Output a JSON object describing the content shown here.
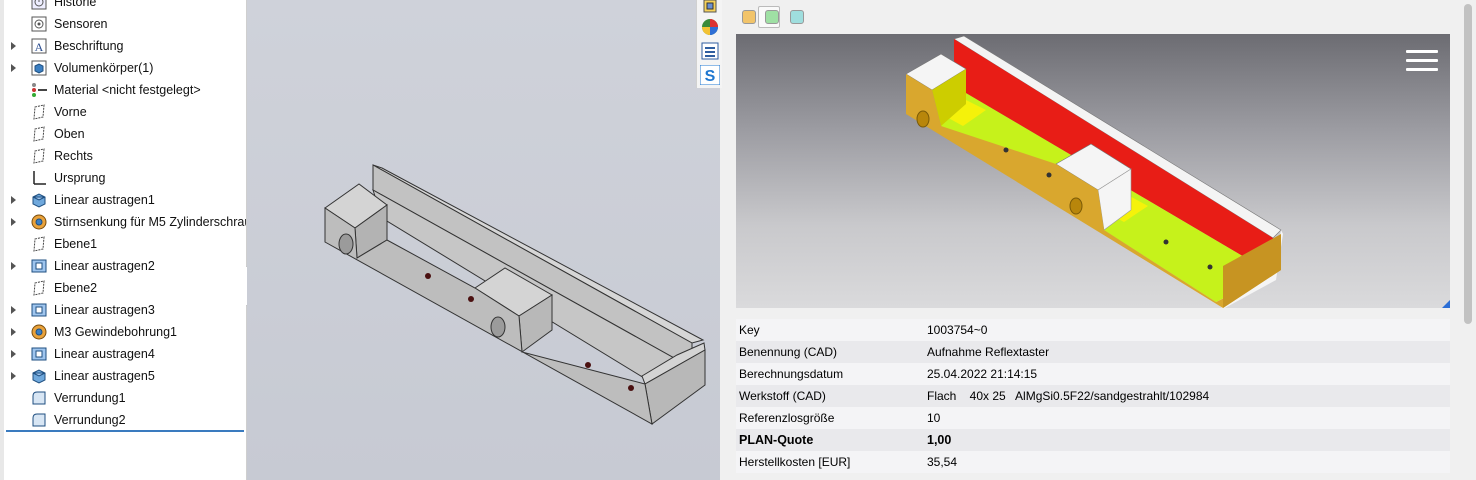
{
  "feature_tree": {
    "items": [
      {
        "label": "Historie",
        "icon": "history-icon",
        "expandable": false
      },
      {
        "label": "Sensoren",
        "icon": "sensor-icon",
        "expandable": false
      },
      {
        "label": "Beschriftung",
        "icon": "annotation-icon",
        "expandable": true
      },
      {
        "label": "Volumenkörper(1)",
        "icon": "solid-bodies-icon",
        "expandable": true
      },
      {
        "label": "Material <nicht festgelegt>",
        "icon": "material-icon",
        "expandable": false
      },
      {
        "label": "Vorne",
        "icon": "plane-icon",
        "expandable": false
      },
      {
        "label": "Oben",
        "icon": "plane-icon",
        "expandable": false
      },
      {
        "label": "Rechts",
        "icon": "plane-icon",
        "expandable": false
      },
      {
        "label": "Ursprung",
        "icon": "origin-icon",
        "expandable": false
      },
      {
        "label": "Linear austragen1",
        "icon": "extrude-icon",
        "expandable": true
      },
      {
        "label": "Stirnsenkung für M5 Zylinderschraul",
        "icon": "hole-wizard-icon",
        "expandable": true
      },
      {
        "label": "Ebene1",
        "icon": "plane-icon",
        "expandable": false
      },
      {
        "label": "Linear austragen2",
        "icon": "cut-extrude-icon",
        "expandable": true
      },
      {
        "label": "Ebene2",
        "icon": "plane-icon",
        "expandable": false
      },
      {
        "label": "Linear austragen3",
        "icon": "cut-extrude-icon",
        "expandable": true
      },
      {
        "label": "M3 Gewindebohrung1",
        "icon": "hole-wizard-icon",
        "expandable": true
      },
      {
        "label": "Linear austragen4",
        "icon": "cut-extrude-icon",
        "expandable": true
      },
      {
        "label": "Linear austragen5",
        "icon": "extrude-icon",
        "expandable": true
      },
      {
        "label": "Verrundung1",
        "icon": "fillet-icon",
        "expandable": false
      },
      {
        "label": "Verrundung2",
        "icon": "fillet-icon",
        "expandable": false
      }
    ]
  },
  "vertical_toolbar": {
    "buttons": [
      "assembly-icon",
      "appearance-icon",
      "properties-icon",
      "plugin-s-icon"
    ]
  },
  "colors": {
    "swatch_1": "#f2c46a",
    "swatch_2": "#9fe0a4",
    "swatch_3": "#9fdede",
    "part_gray": "#c8c8c8",
    "preview_orange": "#d9a72e",
    "preview_red": "#e81d16",
    "preview_lime": "#c6f21b",
    "preview_yellow": "#f5f20a",
    "accent": "#2b6ed6"
  },
  "properties": {
    "rows": [
      {
        "key": "Key",
        "value": "1003754~0",
        "bold": false
      },
      {
        "key": "Benennung (CAD)",
        "value": "Aufnahme Reflextaster",
        "bold": false
      },
      {
        "key": "Berechnungsdatum",
        "value": "25.04.2022 21:14:15",
        "bold": false
      },
      {
        "key": "Werkstoff (CAD)",
        "value": "Flach    40x 25   AlMgSi0.5F22/sandgestrahlt/102984",
        "bold": false
      },
      {
        "key": "Referenzlosgröße",
        "value": "10",
        "bold": false
      },
      {
        "key": "PLAN-Quote",
        "value": "1,00",
        "bold": true
      },
      {
        "key": "Herstellkosten [EUR]",
        "value": "35,54",
        "bold": false
      }
    ]
  }
}
